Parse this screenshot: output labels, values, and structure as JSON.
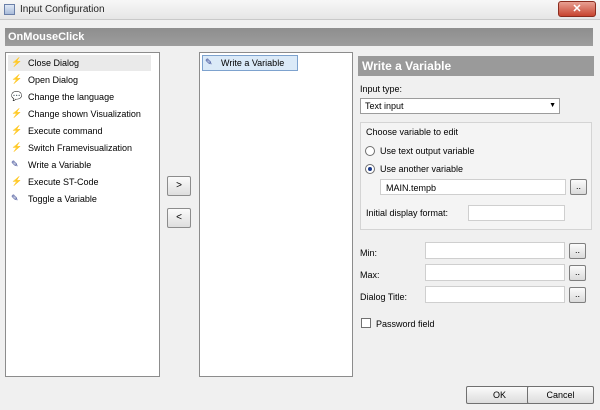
{
  "window": {
    "title": "Input Configuration",
    "close_glyph": "✕"
  },
  "header": {
    "title": "OnMouseClick"
  },
  "left_list": {
    "items": [
      {
        "label": "Close Dialog",
        "icon": "⚡",
        "icon_name": "lightning-icon"
      },
      {
        "label": "Open Dialog",
        "icon": "⚡",
        "icon_name": "lightning-icon"
      },
      {
        "label": "Change the language",
        "icon": "💬",
        "icon_name": "speech-bubble-icon"
      },
      {
        "label": "Change shown Visualization",
        "icon": "⚡",
        "icon_name": "lightning-icon"
      },
      {
        "label": "Execute command",
        "icon": "⚡",
        "icon_name": "lightning-icon"
      },
      {
        "label": "Switch Framevisualization",
        "icon": "⚡",
        "icon_name": "lightning-icon"
      },
      {
        "label": "Write a Variable",
        "icon": "✎",
        "icon_name": "variable-icon"
      },
      {
        "label": "Execute ST-Code",
        "icon": "⚡",
        "icon_name": "lightning-icon"
      },
      {
        "label": "Toggle a Variable",
        "icon": "✎",
        "icon_name": "variable-icon"
      }
    ]
  },
  "buttons": {
    "add": ">",
    "remove": "<",
    "browse": "..",
    "ok": "OK",
    "cancel": "Cancel"
  },
  "mid_list": {
    "items": [
      {
        "label": "Write a Variable",
        "icon": "✎",
        "icon_name": "variable-icon"
      }
    ]
  },
  "panel": {
    "title": "Write a Variable",
    "input_type_label": "Input type:",
    "input_type_value": "Text input",
    "caret": "▼",
    "choose_label": "Choose variable to edit",
    "radio_text_output": "Use text output variable",
    "radio_another": "Use another variable",
    "variable_value": "MAIN.tempb",
    "display_format_label": "Initial display format:",
    "display_format_value": "",
    "min_label": "Min:",
    "max_label": "Max:",
    "dialog_title_label": "Dialog Title:",
    "password_label": "Password field"
  }
}
